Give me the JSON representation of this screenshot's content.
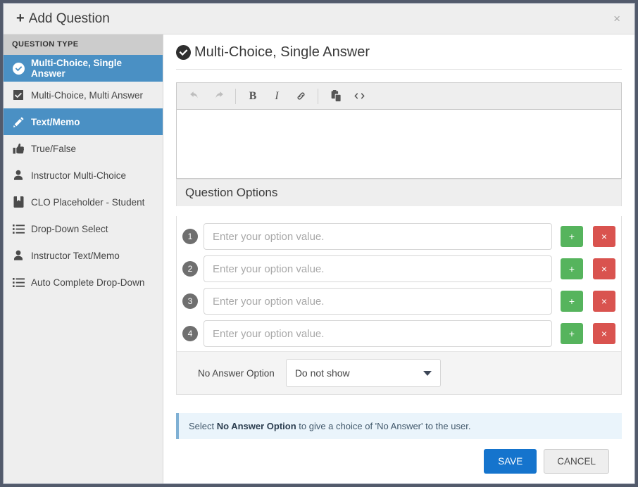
{
  "header": {
    "title": "Add Question",
    "plus_icon": "plus-icon",
    "close_label": "×"
  },
  "sidebar": {
    "heading": "QUESTION TYPE",
    "items": [
      {
        "label": "Multi-Choice, Single Answer",
        "icon": "check-circle-icon",
        "active": true
      },
      {
        "label": "Multi-Choice, Multi Answer",
        "icon": "check-square-icon",
        "active": false
      },
      {
        "label": "Text/Memo",
        "icon": "pencil-icon",
        "active": true
      },
      {
        "label": "True/False",
        "icon": "thumbs-up-icon",
        "active": false
      },
      {
        "label": "Instructor Multi-Choice",
        "icon": "user-icon",
        "active": false
      },
      {
        "label": "CLO Placeholder - Student",
        "icon": "bookmark-icon",
        "active": false
      },
      {
        "label": "Drop-Down Select",
        "icon": "list-ul-icon",
        "active": false
      },
      {
        "label": "Instructor Text/Memo",
        "icon": "user-icon",
        "active": false
      },
      {
        "label": "Auto Complete Drop-Down",
        "icon": "list-ul-icon",
        "active": false
      }
    ]
  },
  "main": {
    "title": "Multi-Choice, Single Answer",
    "title_icon": "check-circle-icon",
    "editor": {
      "toolbar": [
        {
          "name": "undo-icon",
          "label": "undo",
          "disabled": true
        },
        {
          "name": "redo-icon",
          "label": "redo",
          "disabled": true
        },
        {
          "name": "separator",
          "label": "",
          "disabled": false
        },
        {
          "name": "bold-icon",
          "label": "B",
          "disabled": false
        },
        {
          "name": "italic-icon",
          "label": "I",
          "disabled": false
        },
        {
          "name": "link-icon",
          "label": "link",
          "disabled": false
        },
        {
          "name": "separator",
          "label": "",
          "disabled": false
        },
        {
          "name": "paste-icon",
          "label": "paste",
          "disabled": false
        },
        {
          "name": "code-icon",
          "label": "<>",
          "disabled": false
        }
      ],
      "content": ""
    },
    "options": {
      "heading": "Question Options",
      "rows": [
        {
          "number": "1",
          "value": "",
          "placeholder": "Enter your option value.",
          "add_label": "+",
          "delete_label": "×"
        },
        {
          "number": "2",
          "value": "",
          "placeholder": "Enter your option value.",
          "add_label": "+",
          "delete_label": "×"
        },
        {
          "number": "3",
          "value": "",
          "placeholder": "Enter your option value.",
          "add_label": "+",
          "delete_label": "×"
        },
        {
          "number": "4",
          "value": "",
          "placeholder": "Enter your option value.",
          "add_label": "+",
          "delete_label": "×"
        }
      ],
      "no_answer": {
        "label": "No Answer Option",
        "selected": "Do not show",
        "options": [
          "Do not show"
        ]
      }
    },
    "info": {
      "prefix": "Select ",
      "strong": "No Answer Option",
      "suffix": " to give a choice of 'No Answer' to the user."
    }
  },
  "footer": {
    "save_label": "SAVE",
    "cancel_label": "CANCEL"
  },
  "colors": {
    "accent_blue": "#4a90c4",
    "save_blue": "#1574cd",
    "add_green": "#56b45d",
    "delete_red": "#d9534f",
    "info_bg": "#eaf4fb",
    "info_border": "#7fb0d4",
    "sidebar_bg": "#eeeeee",
    "sidebar_header_bg": "#cccccc",
    "outer_bg": "#525a6b"
  }
}
